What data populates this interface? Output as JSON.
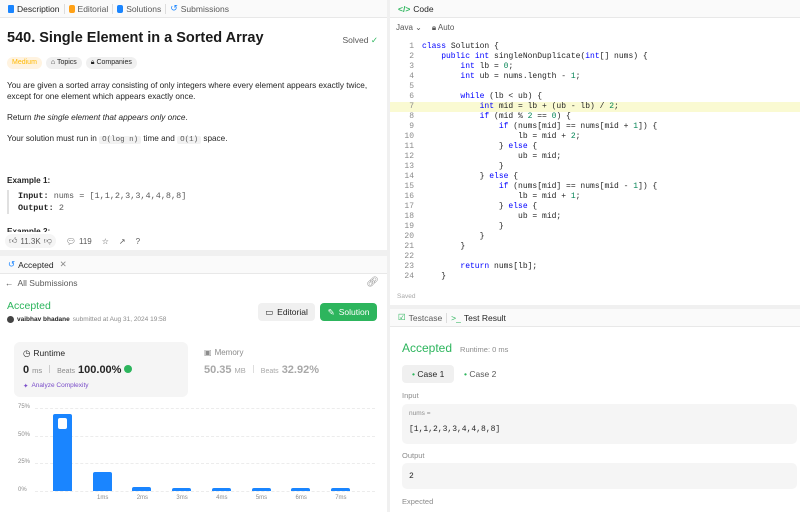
{
  "desc": {
    "tabs": [
      "Description",
      "Editorial",
      "Solutions",
      "Submissions"
    ],
    "title": "540. Single Element in a Sorted Array",
    "solved": "Solved",
    "chips": [
      "Medium",
      "Topics",
      "Companies"
    ],
    "p1": "You are given a sorted array consisting of only integers where every element appears exactly twice, except for one element which appears exactly once.",
    "p2_pre": "Return ",
    "p2_em": "the single element that appears only once",
    "p2_post": ".",
    "p3_pre": "Your solution must run in ",
    "p3_code1": "O(log n)",
    "p3_mid": " time and ",
    "p3_code2": "O(1)",
    "p3_post": " space.",
    "example_title": "Example 1:",
    "input_label": "Input:",
    "input_value": " nums = [1,1,2,3,3,4,4,8,8]",
    "output_label": "Output:",
    "output_value": " 2",
    "next_example": "Example 2:",
    "likes": "11.3K",
    "comments": "119"
  },
  "accepted_panel": {
    "tab": "Accepted",
    "back": "All Submissions",
    "status": "Accepted",
    "user": "vaibhav bhadane",
    "submitted": "submitted at Aug 31, 2024 19:58",
    "editorial_btn": "Editorial",
    "solution_btn": "Solution",
    "runtime_label": "Runtime",
    "runtime_value": "0",
    "runtime_unit": "ms",
    "beats_label": "Beats",
    "runtime_beats": "100.00%",
    "analyze": "Analyze Complexity",
    "memory_label": "Memory",
    "memory_value": "50.35",
    "memory_unit": "MB",
    "memory_beats": "32.92%"
  },
  "chart_data": {
    "type": "bar",
    "categories": [
      "0ms",
      "1ms",
      "2ms",
      "3ms",
      "4ms",
      "5ms",
      "6ms",
      "7ms"
    ],
    "category_labels": [
      "",
      "1ms",
      "2ms",
      "3ms",
      "4ms",
      "5ms",
      "6ms",
      "7ms"
    ],
    "values": [
      70,
      17,
      4,
      3,
      3,
      3,
      3,
      3
    ],
    "yticks": [
      "75%",
      "50%",
      "25%",
      "0%"
    ],
    "ylim": [
      0,
      75
    ],
    "highlight_index": 0,
    "bar_color": "#1a85ff"
  },
  "code": {
    "tab": "Code",
    "language": "Java",
    "auto": "Auto",
    "saved": "Saved",
    "lines": [
      "class Solution {",
      "    public int singleNonDuplicate(int[] nums) {",
      "        int lb = 0;",
      "        int ub = nums.length - 1;",
      "",
      "        while (lb < ub) {",
      "            int mid = lb + (ub - lb) / 2;",
      "            if (mid % 2 == 0) {",
      "                if (nums[mid] == nums[mid + 1]) {",
      "                    lb = mid + 2;",
      "                } else {",
      "                    ub = mid;",
      "                }",
      "            } else {",
      "                if (nums[mid] == nums[mid - 1]) {",
      "                    lb = mid + 1;",
      "                } else {",
      "                    ub = mid;",
      "                }",
      "            }",
      "        }",
      "",
      "        return nums[lb];",
      "    }"
    ]
  },
  "test": {
    "tab1": "Testcase",
    "tab2": "Test Result",
    "status": "Accepted",
    "runtime": "Runtime: 0 ms",
    "case1": "Case 1",
    "case2": "Case 2",
    "input_label": "Input",
    "var_name": "nums =",
    "var_value": "[1,1,2,3,3,4,4,8,8]",
    "output_label": "Output",
    "output_value": "2",
    "expected_label": "Expected"
  },
  "colors": {
    "accepted_green": "#2db55d",
    "accent_blue": "#1a85ff",
    "medium": "#ffb800"
  }
}
